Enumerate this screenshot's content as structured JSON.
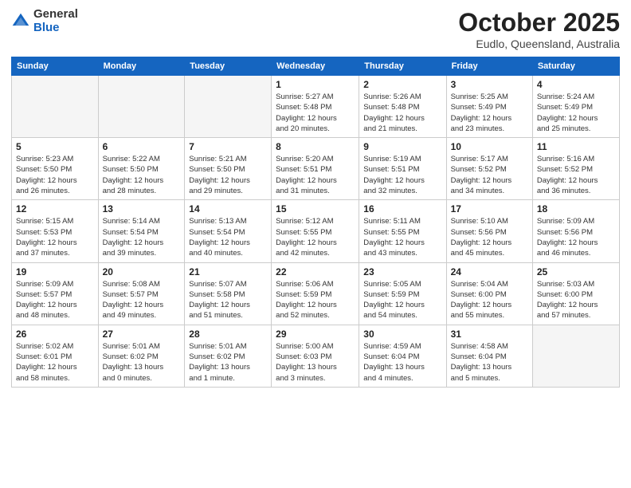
{
  "header": {
    "logo_line1": "General",
    "logo_line2": "Blue",
    "title": "October 2025",
    "location": "Eudlo, Queensland, Australia"
  },
  "weekdays": [
    "Sunday",
    "Monday",
    "Tuesday",
    "Wednesday",
    "Thursday",
    "Friday",
    "Saturday"
  ],
  "weeks": [
    [
      {
        "date": "",
        "info": ""
      },
      {
        "date": "",
        "info": ""
      },
      {
        "date": "",
        "info": ""
      },
      {
        "date": "1",
        "info": "Sunrise: 5:27 AM\nSunset: 5:48 PM\nDaylight: 12 hours\nand 20 minutes."
      },
      {
        "date": "2",
        "info": "Sunrise: 5:26 AM\nSunset: 5:48 PM\nDaylight: 12 hours\nand 21 minutes."
      },
      {
        "date": "3",
        "info": "Sunrise: 5:25 AM\nSunset: 5:49 PM\nDaylight: 12 hours\nand 23 minutes."
      },
      {
        "date": "4",
        "info": "Sunrise: 5:24 AM\nSunset: 5:49 PM\nDaylight: 12 hours\nand 25 minutes."
      }
    ],
    [
      {
        "date": "5",
        "info": "Sunrise: 5:23 AM\nSunset: 5:50 PM\nDaylight: 12 hours\nand 26 minutes."
      },
      {
        "date": "6",
        "info": "Sunrise: 5:22 AM\nSunset: 5:50 PM\nDaylight: 12 hours\nand 28 minutes."
      },
      {
        "date": "7",
        "info": "Sunrise: 5:21 AM\nSunset: 5:50 PM\nDaylight: 12 hours\nand 29 minutes."
      },
      {
        "date": "8",
        "info": "Sunrise: 5:20 AM\nSunset: 5:51 PM\nDaylight: 12 hours\nand 31 minutes."
      },
      {
        "date": "9",
        "info": "Sunrise: 5:19 AM\nSunset: 5:51 PM\nDaylight: 12 hours\nand 32 minutes."
      },
      {
        "date": "10",
        "info": "Sunrise: 5:17 AM\nSunset: 5:52 PM\nDaylight: 12 hours\nand 34 minutes."
      },
      {
        "date": "11",
        "info": "Sunrise: 5:16 AM\nSunset: 5:52 PM\nDaylight: 12 hours\nand 36 minutes."
      }
    ],
    [
      {
        "date": "12",
        "info": "Sunrise: 5:15 AM\nSunset: 5:53 PM\nDaylight: 12 hours\nand 37 minutes."
      },
      {
        "date": "13",
        "info": "Sunrise: 5:14 AM\nSunset: 5:54 PM\nDaylight: 12 hours\nand 39 minutes."
      },
      {
        "date": "14",
        "info": "Sunrise: 5:13 AM\nSunset: 5:54 PM\nDaylight: 12 hours\nand 40 minutes."
      },
      {
        "date": "15",
        "info": "Sunrise: 5:12 AM\nSunset: 5:55 PM\nDaylight: 12 hours\nand 42 minutes."
      },
      {
        "date": "16",
        "info": "Sunrise: 5:11 AM\nSunset: 5:55 PM\nDaylight: 12 hours\nand 43 minutes."
      },
      {
        "date": "17",
        "info": "Sunrise: 5:10 AM\nSunset: 5:56 PM\nDaylight: 12 hours\nand 45 minutes."
      },
      {
        "date": "18",
        "info": "Sunrise: 5:09 AM\nSunset: 5:56 PM\nDaylight: 12 hours\nand 46 minutes."
      }
    ],
    [
      {
        "date": "19",
        "info": "Sunrise: 5:09 AM\nSunset: 5:57 PM\nDaylight: 12 hours\nand 48 minutes."
      },
      {
        "date": "20",
        "info": "Sunrise: 5:08 AM\nSunset: 5:57 PM\nDaylight: 12 hours\nand 49 minutes."
      },
      {
        "date": "21",
        "info": "Sunrise: 5:07 AM\nSunset: 5:58 PM\nDaylight: 12 hours\nand 51 minutes."
      },
      {
        "date": "22",
        "info": "Sunrise: 5:06 AM\nSunset: 5:59 PM\nDaylight: 12 hours\nand 52 minutes."
      },
      {
        "date": "23",
        "info": "Sunrise: 5:05 AM\nSunset: 5:59 PM\nDaylight: 12 hours\nand 54 minutes."
      },
      {
        "date": "24",
        "info": "Sunrise: 5:04 AM\nSunset: 6:00 PM\nDaylight: 12 hours\nand 55 minutes."
      },
      {
        "date": "25",
        "info": "Sunrise: 5:03 AM\nSunset: 6:00 PM\nDaylight: 12 hours\nand 57 minutes."
      }
    ],
    [
      {
        "date": "26",
        "info": "Sunrise: 5:02 AM\nSunset: 6:01 PM\nDaylight: 12 hours\nand 58 minutes."
      },
      {
        "date": "27",
        "info": "Sunrise: 5:01 AM\nSunset: 6:02 PM\nDaylight: 13 hours\nand 0 minutes."
      },
      {
        "date": "28",
        "info": "Sunrise: 5:01 AM\nSunset: 6:02 PM\nDaylight: 13 hours\nand 1 minute."
      },
      {
        "date": "29",
        "info": "Sunrise: 5:00 AM\nSunset: 6:03 PM\nDaylight: 13 hours\nand 3 minutes."
      },
      {
        "date": "30",
        "info": "Sunrise: 4:59 AM\nSunset: 6:04 PM\nDaylight: 13 hours\nand 4 minutes."
      },
      {
        "date": "31",
        "info": "Sunrise: 4:58 AM\nSunset: 6:04 PM\nDaylight: 13 hours\nand 5 minutes."
      },
      {
        "date": "",
        "info": ""
      }
    ]
  ]
}
